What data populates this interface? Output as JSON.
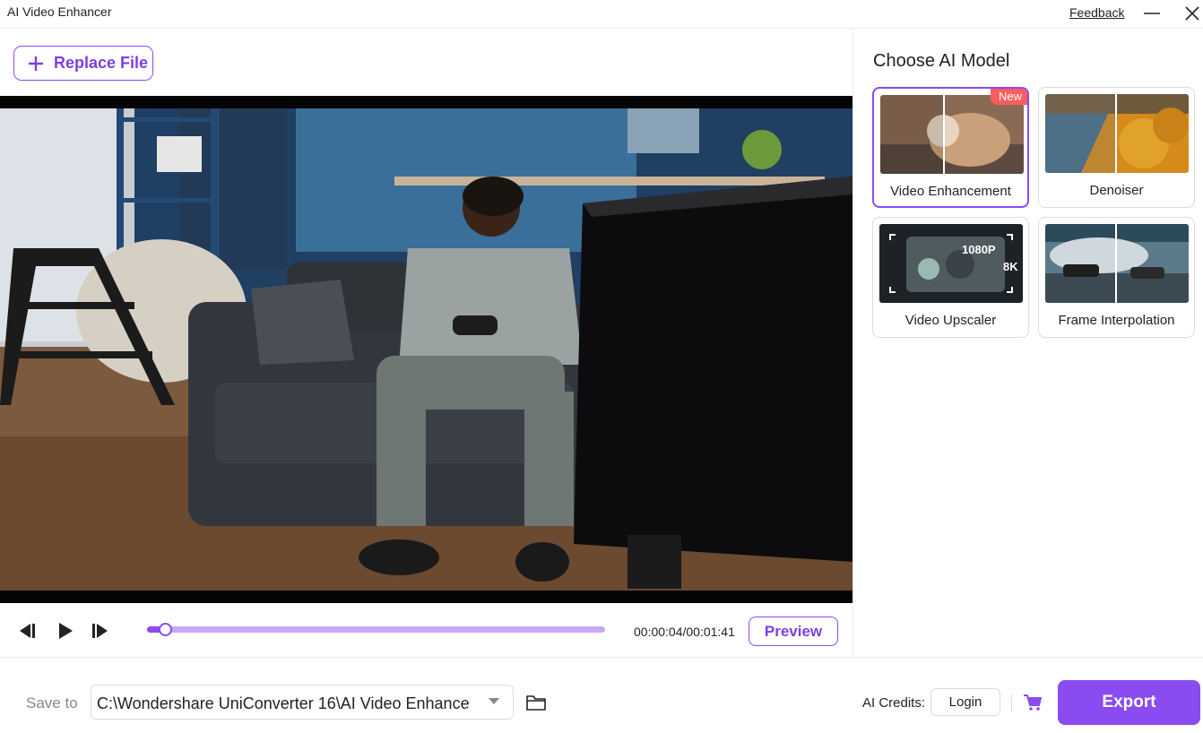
{
  "window": {
    "title": "AI Video Enhancer",
    "feedback_label": "Feedback"
  },
  "toolbar": {
    "replace_file_label": "Replace File"
  },
  "player": {
    "current_time": "00:00:04",
    "duration": "00:01:41",
    "timecode": "00:00:04/00:01:41",
    "progress_fraction": 0.04,
    "preview_label": "Preview"
  },
  "models_panel": {
    "title": "Choose AI Model",
    "models": [
      {
        "label": "Video Enhancement",
        "badge": "New",
        "selected": true
      },
      {
        "label": "Denoiser",
        "selected": false
      },
      {
        "label": "Video Upscaler",
        "selected": false,
        "thumb_text": [
          "1080P",
          "8K"
        ]
      },
      {
        "label": "Frame Interpolation",
        "selected": false
      }
    ]
  },
  "bottom_bar": {
    "save_to_label": "Save to",
    "save_path": "C:\\Wondershare UniConverter 16\\AI Video Enhance",
    "ai_credits_label": "AI Credits:",
    "login_label": "Login",
    "export_label": "Export"
  },
  "colors": {
    "accent": "#8a4bf0",
    "accent_light": "#c8a8f6",
    "badge": "#ff5d5d"
  }
}
